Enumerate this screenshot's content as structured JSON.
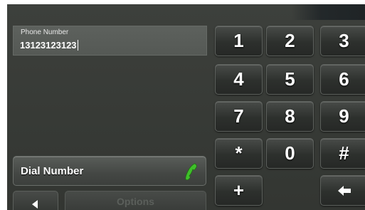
{
  "phone_field": {
    "label": "Phone Number",
    "value": "13123123123"
  },
  "keypad": {
    "keys": [
      "1",
      "2",
      "3",
      "4",
      "5",
      "6",
      "7",
      "8",
      "9",
      "*",
      "0",
      "#",
      "+"
    ],
    "backspace_icon": "backspace-arrow-icon"
  },
  "actions": {
    "dial_label": "Dial Number",
    "dial_icon": "phone-icon",
    "back_icon": "back-arrow-icon",
    "options_label": "Options"
  },
  "colors": {
    "background": "#373a36",
    "phone_icon": "#3fbf2a",
    "options_disabled_text": "#5b5f5b"
  }
}
